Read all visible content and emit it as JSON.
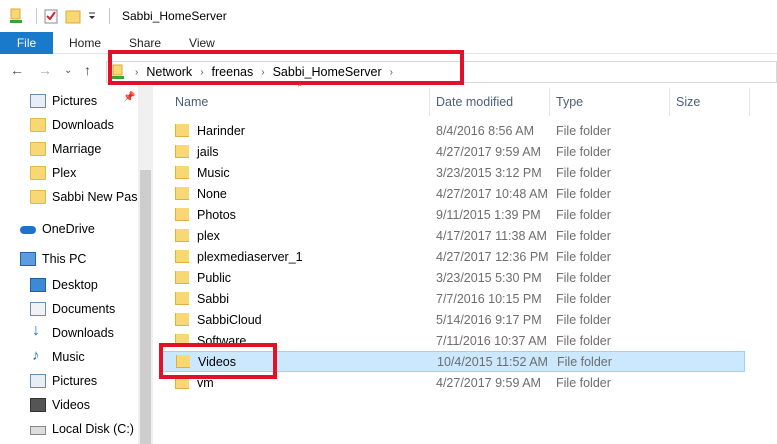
{
  "window": {
    "title": "Sabbi_HomeServer"
  },
  "ribbon": {
    "tabs": [
      {
        "label": "File"
      },
      {
        "label": "Home"
      },
      {
        "label": "Share"
      },
      {
        "label": "View"
      }
    ]
  },
  "address": {
    "crumbs": [
      "Network",
      "freenas",
      "Sabbi_HomeServer"
    ]
  },
  "sidebar": {
    "items": [
      {
        "label": "Pictures",
        "icon": "pictures-icon"
      },
      {
        "label": "Downloads",
        "icon": "folder-icon"
      },
      {
        "label": "Marriage",
        "icon": "folder-icon"
      },
      {
        "label": "Plex",
        "icon": "folder-icon"
      },
      {
        "label": "Sabbi New Passp",
        "icon": "folder-icon"
      },
      {
        "label": "OneDrive",
        "icon": "onedrive-icon"
      },
      {
        "label": "This PC",
        "icon": "this-pc-icon"
      },
      {
        "label": "Desktop",
        "icon": "desktop-icon"
      },
      {
        "label": "Documents",
        "icon": "documents-icon"
      },
      {
        "label": "Downloads",
        "icon": "downloads-icon"
      },
      {
        "label": "Music",
        "icon": "music-icon"
      },
      {
        "label": "Pictures",
        "icon": "pictures-icon"
      },
      {
        "label": "Videos",
        "icon": "videos-icon"
      },
      {
        "label": "Local Disk (C:)",
        "icon": "disk-icon"
      }
    ]
  },
  "columns": {
    "name": "Name",
    "date": "Date modified",
    "type": "Type",
    "size": "Size"
  },
  "files": [
    {
      "name": "Harinder",
      "date": "8/4/2016 8:56 AM",
      "type": "File folder"
    },
    {
      "name": "jails",
      "date": "4/27/2017 9:59 AM",
      "type": "File folder"
    },
    {
      "name": "Music",
      "date": "3/23/2015 3:12 PM",
      "type": "File folder"
    },
    {
      "name": "None",
      "date": "4/27/2017 10:48 AM",
      "type": "File folder"
    },
    {
      "name": "Photos",
      "date": "9/11/2015 1:39 PM",
      "type": "File folder"
    },
    {
      "name": "plex",
      "date": "4/17/2017 11:38 AM",
      "type": "File folder"
    },
    {
      "name": "plexmediaserver_1",
      "date": "4/27/2017 12:36 PM",
      "type": "File folder"
    },
    {
      "name": "Public",
      "date": "3/23/2015 5:30 PM",
      "type": "File folder"
    },
    {
      "name": "Sabbi",
      "date": "7/7/2016 10:15 PM",
      "type": "File folder"
    },
    {
      "name": "SabbiCloud",
      "date": "5/14/2016 9:17 PM",
      "type": "File folder"
    },
    {
      "name": "Software",
      "date": "7/11/2016 10:37 AM",
      "type": "File folder"
    },
    {
      "name": "Videos",
      "date": "10/4/2015 11:52 AM",
      "type": "File folder",
      "selected": true
    },
    {
      "name": "vm",
      "date": "4/27/2017 9:59 AM",
      "type": "File folder"
    }
  ],
  "colors": {
    "accent": "#1979ca",
    "selection": "#cce8ff",
    "highlight": "#e3102a"
  }
}
